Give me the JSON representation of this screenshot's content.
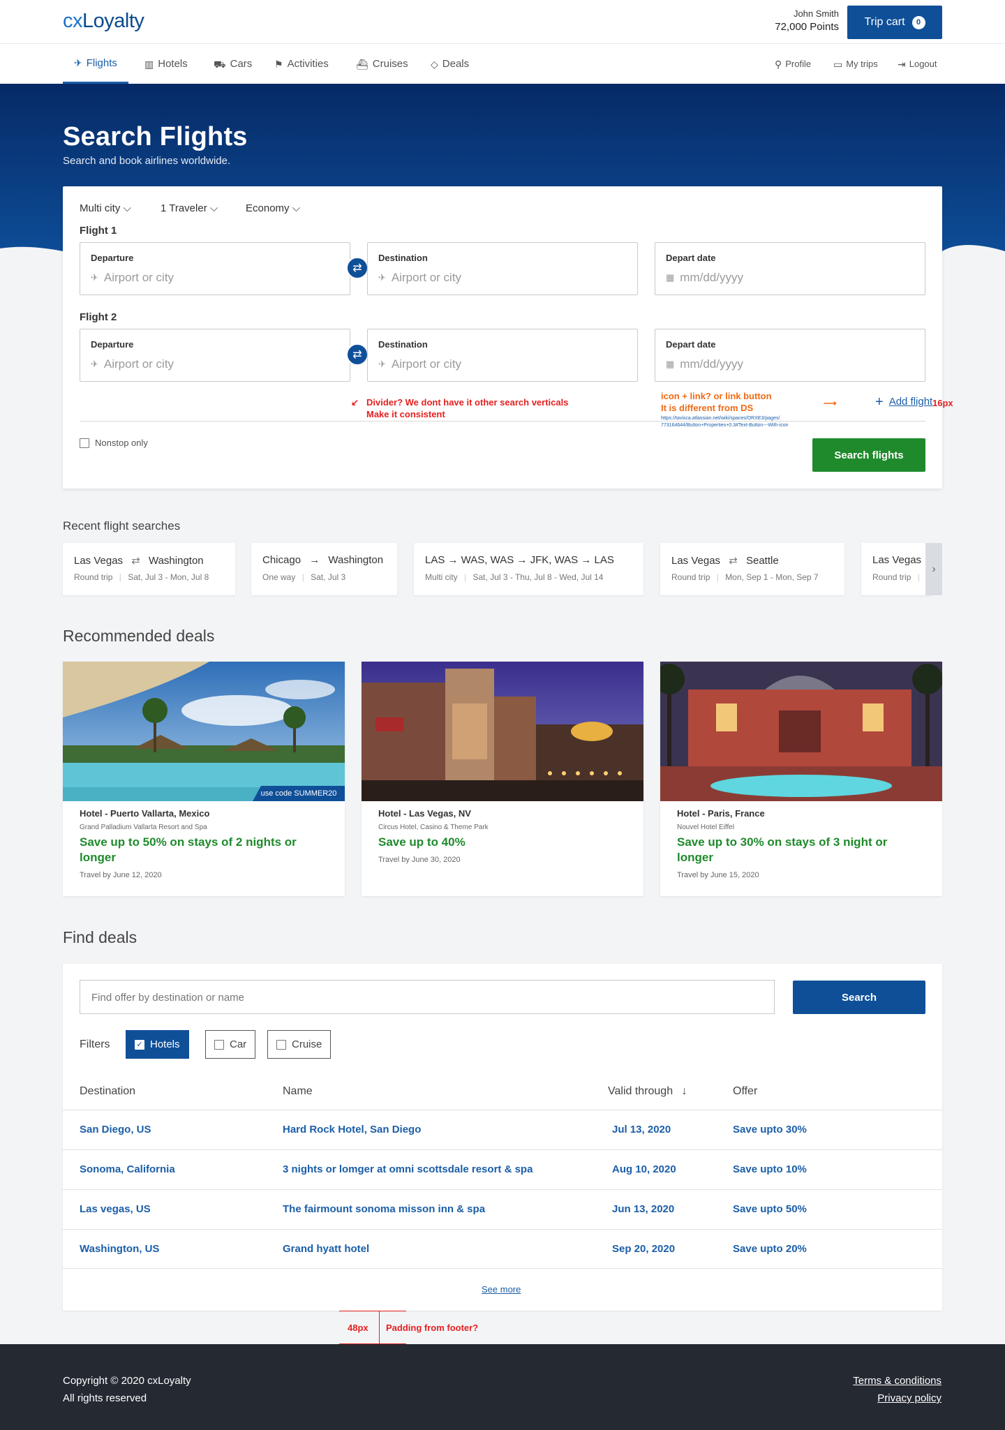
{
  "header": {
    "logo_cx": "cx",
    "logo_rest": "Loyalty",
    "user_name": "John Smith",
    "user_points": "72,000 Points",
    "cart_label": "Trip cart",
    "cart_count": "0"
  },
  "nav": {
    "items": [
      "Flights",
      "Hotels",
      "Cars",
      "Activities",
      "Cruises",
      "Deals"
    ],
    "right": [
      "Profile",
      "My trips",
      "Logout"
    ]
  },
  "hero": {
    "title": "Search Flights",
    "subtitle": "Search and book airlines worldwide."
  },
  "search": {
    "trip_type": "Multi city",
    "travelers": "1 Traveler",
    "cabin": "Economy",
    "flights": [
      {
        "label": "Flight 1",
        "departure_label": "Departure",
        "departure_ph": "Airport or city",
        "destination_label": "Destination",
        "destination_ph": "Airport or city",
        "date_label": "Depart date",
        "date_ph": "mm/dd/yyyy"
      },
      {
        "label": "Flight 2",
        "departure_label": "Departure",
        "departure_ph": "Airport or city",
        "destination_label": "Destination",
        "destination_ph": "Airport or city",
        "date_label": "Depart date",
        "date_ph": "mm/dd/yyyy"
      }
    ],
    "add_flight": "Add flight",
    "nonstop": "Nonstop only",
    "submit": "Search flights",
    "annotations": {
      "divider_1": "Divider? We dont have it other search verticals",
      "divider_2": "Make it consistent",
      "icon_1": "icon + link? or link button",
      "icon_2": "It is different from DS",
      "link_1": "https://tavisca.atlassian.net/wiki/spaces/ORXE3/pages/",
      "link_2": "773164644/Button+Properties+0.3#Text-Button---With-icon",
      "spacing": "16px"
    }
  },
  "recent": {
    "title": "Recent flight searches",
    "items": [
      {
        "from": "Las Vegas",
        "sep": "⇄",
        "to": "Washington",
        "type": "Round trip",
        "dates": "Sat, Jul 3 - Mon, Jul 8"
      },
      {
        "from": "Chicago",
        "sep": "→",
        "to": "Washington",
        "type": "One way",
        "dates": "Sat, Jul 3"
      },
      {
        "from": "LAS → WAS, WAS → JFK, WAS → LAS",
        "sep": "",
        "to": "",
        "type": "Multi city",
        "dates": "Sat, Jul 3 - Thu, Jul 8 - Wed, Jul 14"
      },
      {
        "from": "Las Vegas",
        "sep": "⇄",
        "to": "Seattle",
        "type": "Round trip",
        "dates": "Mon, Sep 1 - Mon, Sep 7"
      },
      {
        "from": "Las Vegas",
        "sep": "",
        "to": "",
        "type": "Round trip",
        "dates": ""
      }
    ]
  },
  "deals": {
    "title": "Recommended deals",
    "items": [
      {
        "kind": "Hotel - Puerto Vallarta, Mexico",
        "name": "Grand Palladium Vallarta Resort and Spa",
        "offer": "Save up to 50% on stays of 2 nights or longer",
        "travel": "Travel by June 12, 2020",
        "code": "use code SUMMER20"
      },
      {
        "kind": "Hotel - Las Vegas, NV",
        "name": "Circus Hotel, Casino & Theme Park",
        "offer": "Save up to 40%",
        "travel": "Travel by June 30, 2020"
      },
      {
        "kind": "Hotel - Paris, France",
        "name": "Nouvel Hotel Eiffel",
        "offer": "Save up to 30% on stays of 3 night or longer",
        "travel": "Travel by June 15, 2020"
      }
    ]
  },
  "find": {
    "title": "Find deals",
    "placeholder": "Find offer by destination or name",
    "search": "Search",
    "filters_label": "Filters",
    "filters": [
      "Hotels",
      "Car",
      "Cruise"
    ],
    "columns": [
      "Destination",
      "Name",
      "Valid through",
      "Offer"
    ],
    "rows": [
      {
        "dest": "San Diego, US",
        "name": "Hard Rock Hotel, San Diego",
        "valid": "Jul 13, 2020",
        "offer": "Save upto 30%"
      },
      {
        "dest": "Sonoma, California",
        "name": "3 nights or lomger at omni scottsdale resort & spa",
        "valid": "Aug 10, 2020",
        "offer": "Save upto 10%"
      },
      {
        "dest": "Las vegas, US",
        "name": "The fairmount sonoma misson inn & spa",
        "valid": "Jun 13, 2020",
        "offer": "Save upto 50%"
      },
      {
        "dest": "Washington, US",
        "name": "Grand hyatt hotel",
        "valid": "Sep 20, 2020",
        "offer": "Save upto 20%"
      }
    ],
    "see_more": "See more"
  },
  "annotation_footer": {
    "px": "48px",
    "text": "Padding from footer?"
  },
  "footer": {
    "copyright": "Copyright © 2020 cxLoyalty",
    "rights": "All rights reserved",
    "terms": "Terms & conditions",
    "privacy": "Privacy policy"
  }
}
